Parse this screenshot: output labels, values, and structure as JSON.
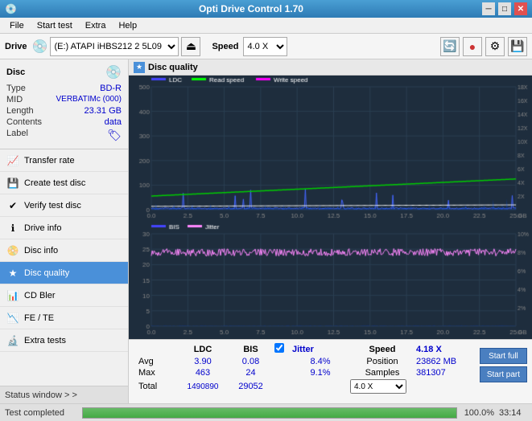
{
  "titlebar": {
    "title": "Opti Drive Control 1.70",
    "icon": "💿",
    "minimize_label": "─",
    "maximize_label": "□",
    "close_label": "✕"
  },
  "menubar": {
    "items": [
      {
        "label": "File"
      },
      {
        "label": "Start test"
      },
      {
        "label": "Extra"
      },
      {
        "label": "Help"
      }
    ]
  },
  "toolbar": {
    "drive_label": "Drive",
    "drive_value": "(E:) ATAPI iHBS212  2 5L09",
    "speed_label": "Speed",
    "speed_value": "4.0 X"
  },
  "disc_panel": {
    "title": "Disc",
    "type_label": "Type",
    "type_value": "BD-R",
    "mid_label": "MID",
    "mid_value": "VERBATIMc (000)",
    "length_label": "Length",
    "length_value": "23.31 GB",
    "contents_label": "Contents",
    "contents_value": "data",
    "label_label": "Label"
  },
  "nav_items": [
    {
      "label": "Transfer rate",
      "icon": "📈",
      "active": false
    },
    {
      "label": "Create test disc",
      "icon": "💾",
      "active": false
    },
    {
      "label": "Verify test disc",
      "icon": "✔",
      "active": false
    },
    {
      "label": "Drive info",
      "icon": "ℹ",
      "active": false
    },
    {
      "label": "Disc info",
      "icon": "📀",
      "active": false
    },
    {
      "label": "Disc quality",
      "icon": "★",
      "active": true
    },
    {
      "label": "CD Bler",
      "icon": "📊",
      "active": false
    },
    {
      "label": "FE / TE",
      "icon": "📉",
      "active": false
    },
    {
      "label": "Extra tests",
      "icon": "🔬",
      "active": false
    }
  ],
  "status_window": {
    "label": "Status window > >"
  },
  "dq_panel": {
    "title": "Disc quality"
  },
  "legend": {
    "ldc_label": "LDC",
    "read_label": "Read speed",
    "write_label": "Write speed",
    "bis_label": "BIS",
    "jitter_label": "Jitter"
  },
  "stats": {
    "col_ldc": "LDC",
    "col_bis": "BIS",
    "col_jitter": "Jitter",
    "col_speed": "Speed",
    "col_position": "Position",
    "col_samples": "Samples",
    "avg_label": "Avg",
    "max_label": "Max",
    "total_label": "Total",
    "ldc_avg": "3.90",
    "ldc_max": "463",
    "ldc_total": "1490890",
    "bis_avg": "0.08",
    "bis_max": "24",
    "bis_total": "29052",
    "jitter_avg": "8.4%",
    "jitter_max": "9.1%",
    "jitter_total": "",
    "speed_val": "4.18 X",
    "speed_select": "4.0 X",
    "position_val": "23862 MB",
    "samples_val": "381307",
    "start_full_label": "Start full",
    "start_part_label": "Start part",
    "jitter_checked": true
  },
  "progress": {
    "percent": 100,
    "percent_label": "100.0%",
    "time_label": "33:14"
  },
  "status_bar": {
    "message": "Test completed"
  }
}
